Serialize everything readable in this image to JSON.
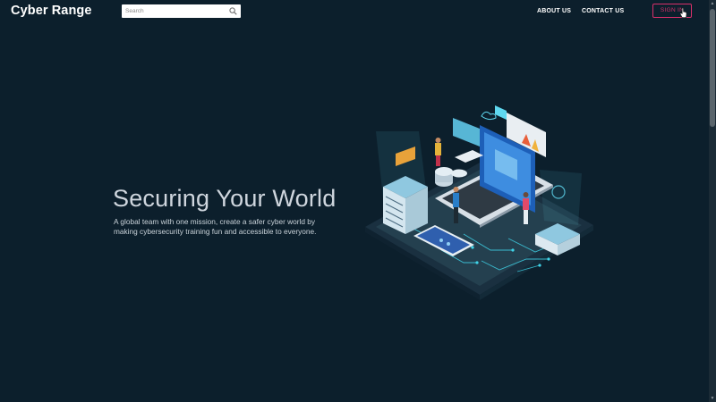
{
  "header": {
    "brand": "Cyber Range",
    "search": {
      "placeholder": "Search",
      "value": "",
      "icon": "search-icon"
    },
    "nav": {
      "about": "ABOUT US",
      "contact": "CONTACT US"
    },
    "sign_in": "SIGN IN"
  },
  "hero": {
    "title": "Securing Your World",
    "subtitle": "A global team with one mission, create a safer cyber world by making cybersecurity training fun and accessible to everyone.",
    "illustration": "isometric-cybersecurity-illustration"
  },
  "colors": {
    "background": "#0c1f2c",
    "accent": "#d8306a",
    "illustration_cyan": "#3fd3e8",
    "text": "#cfd6de"
  },
  "scrollbar": {
    "position": 0.0
  }
}
